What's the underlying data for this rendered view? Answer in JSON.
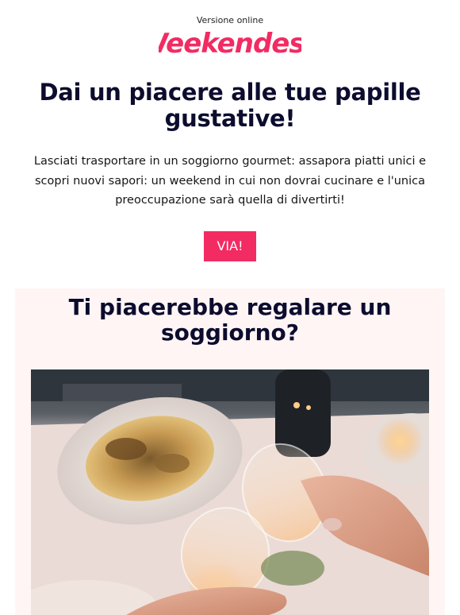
{
  "header": {
    "online_version": "Versione online",
    "logo_text": "Weekendesk",
    "brand_color": "#f22b63"
  },
  "hero": {
    "title": "Dai un piacere alle tue papille gustative!",
    "body": "Lasciati trasportare in un soggiorno gourmet: assapora piatti unici e scopri nuovi sapori: un weekend in cui non dovrai cucinare e l'unica preoccupazione sarà quella di divertirti!",
    "cta_label": "VIA!"
  },
  "gift": {
    "title": "Ti piacerebbe regalare un soggiorno?",
    "background": "#fff5f5"
  }
}
